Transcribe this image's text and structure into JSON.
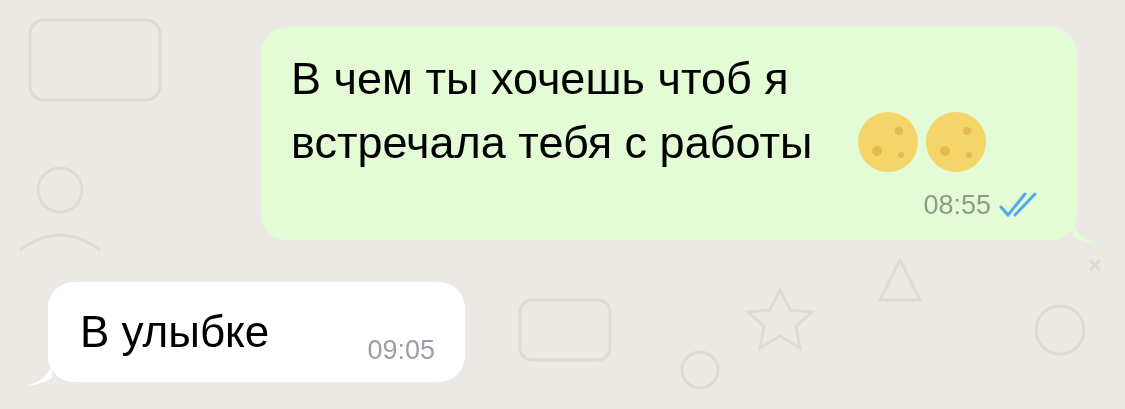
{
  "messages": [
    {
      "outgoing": true,
      "text": "В чем ты хочешь чтоб я встречала тебя с работы",
      "emojis": [
        {
          "kind": "moon"
        },
        {
          "kind": "moon"
        }
      ],
      "time": "08:55",
      "read": true
    },
    {
      "outgoing": false,
      "text": "В улыбке",
      "time": "09:05"
    }
  ]
}
